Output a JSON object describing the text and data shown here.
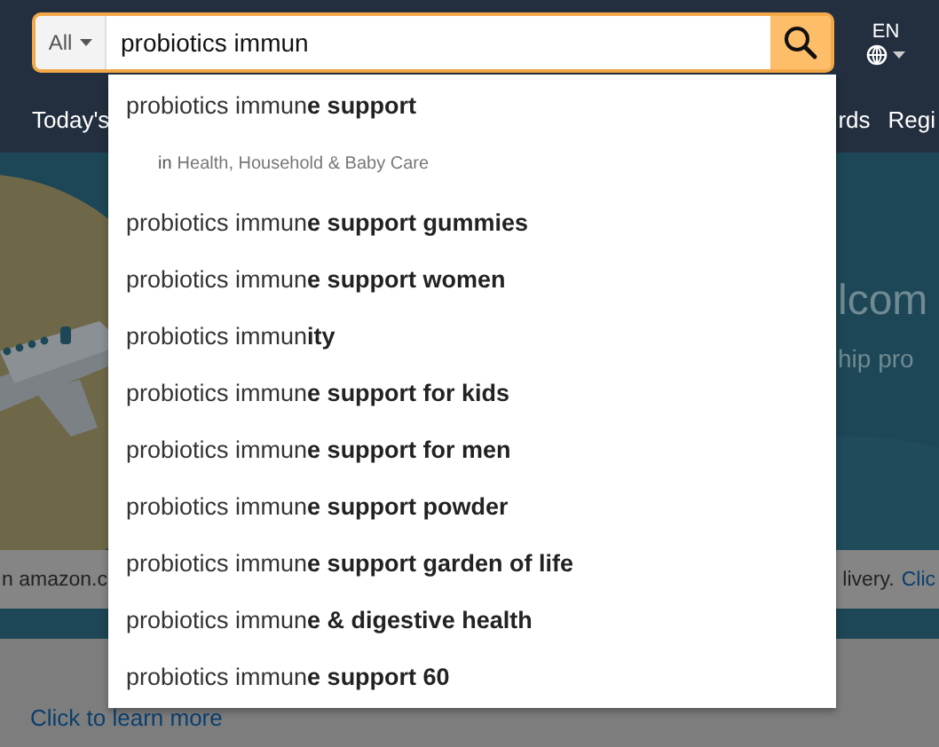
{
  "search": {
    "category": "All",
    "query": "probiotics immun"
  },
  "language": {
    "code": "EN"
  },
  "nav": [
    "Today's",
    "rds",
    "Regi"
  ],
  "hero": {
    "kind": "picture",
    "title": "lcom",
    "subtitle": "hip pro"
  },
  "notice": {
    "left": "n amazon.c",
    "right": "livery.",
    "link": "Clic"
  },
  "promo": {
    "link": "Click to learn more"
  },
  "suggestions": [
    {
      "text": "probiotics immun**e support**",
      "department": {
        "prefix": "in",
        "name": "Health, Household & Baby Care"
      }
    },
    {
      "text": "probiotics immun**e support gummies**"
    },
    {
      "text": "probiotics immun**e support women**"
    },
    {
      "text": "probiotics immun**ity**"
    },
    {
      "text": "probiotics immun**e support for kids**"
    },
    {
      "text": "probiotics immun**e support for men**"
    },
    {
      "text": "probiotics immun**e support powder**"
    },
    {
      "text": "probiotics immun**e support garden of life**"
    },
    {
      "text": "probiotics immun**e & digestive health**"
    },
    {
      "text": "probiotics immun**e support 60**"
    }
  ]
}
